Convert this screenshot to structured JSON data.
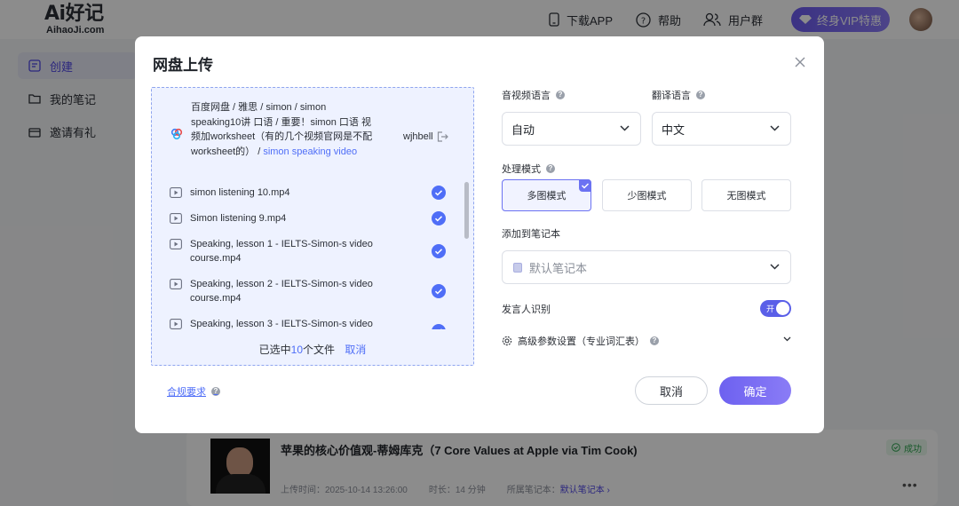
{
  "header": {
    "logo_main": "Ai好记",
    "logo_sub": "AihaoJi.com",
    "download_label": "下载APP",
    "help_label": "帮助",
    "community_label": "用户群",
    "vip_label": "终身VIP特惠"
  },
  "sidebar": {
    "items": [
      {
        "label": "创建"
      },
      {
        "label": "我的笔记"
      },
      {
        "label": "邀请有礼"
      }
    ]
  },
  "note_card": {
    "title": "苹果的核心价值观-蒂姆库克（7 Core Values at Apple via Tim Cook)",
    "upload_time": "上传时间：2025-10-14 13:26:00",
    "duration": "时长：14 分钟",
    "notebook_prefix": "所属笔记本：",
    "notebook_link": "默认笔记本 ›",
    "status": "成功",
    "more": "•••"
  },
  "modal": {
    "title": "网盘上传",
    "breadcrumb_path": "百度网盘 / 雅思 / simon / simon speaking10讲 口语 / 重要！simon 口语 视频加worksheet（有的几个视频官网是不配worksheet的） / ",
    "breadcrumb_current": "simon speaking video",
    "account_name": "wjhbell",
    "files": [
      {
        "name": "simon listening 10.mp4"
      },
      {
        "name": "Simon listening 9.mp4"
      },
      {
        "name": "Speaking, lesson 1 - IELTS-Simon-s video course.mp4"
      },
      {
        "name": "Speaking, lesson 2 - IELTS-Simon-s video course.mp4"
      },
      {
        "name": "Speaking, lesson 3 - IELTS-Simon-s video"
      }
    ],
    "selected_prefix": "已选中",
    "selected_count": "10",
    "selected_suffix": "个文件",
    "deselect_label": "取消",
    "compliance_label": "合规要求",
    "audio_language_label": "音视频语言",
    "audio_language_value": "自动",
    "translate_language_label": "翻译语言",
    "translate_language_value": "中文",
    "mode_label": "处理模式",
    "modes": [
      {
        "label": "多图模式",
        "selected": true
      },
      {
        "label": "少图模式",
        "selected": false
      },
      {
        "label": "无图模式",
        "selected": false
      }
    ],
    "notebook_label": "添加到笔记本",
    "notebook_value": "默认笔记本",
    "speaker_label": "发言人识别",
    "speaker_toggle_text": "开",
    "speaker_enabled": true,
    "advanced_label": "高级参数设置（专业词汇表）",
    "cancel_button": "取消",
    "confirm_button": "确定"
  },
  "colors": {
    "accent": "#4f6ef7",
    "primary_button": "#7a6ef4",
    "panel_bg": "#eef2ff",
    "success": "#2ea44f"
  }
}
